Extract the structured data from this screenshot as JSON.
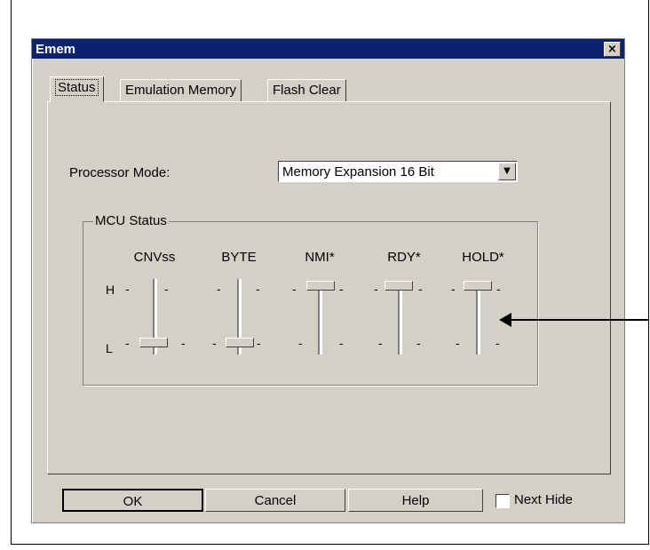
{
  "window": {
    "title": "Emem",
    "close_glyph": "×"
  },
  "tabs": [
    {
      "label": "Status",
      "active": true
    },
    {
      "label": "Emulation Memory",
      "active": false
    },
    {
      "label": "Flash Clear",
      "active": false
    }
  ],
  "processor_mode": {
    "label": "Processor Mode:",
    "value": "Memory Expansion 16 Bit"
  },
  "mcu_status": {
    "title": "MCU Status",
    "h_label": "H",
    "l_label": "L",
    "pins": [
      {
        "name": "CNVss",
        "level": "L"
      },
      {
        "name": "BYTE",
        "level": "L"
      },
      {
        "name": "NMI*",
        "level": "H"
      },
      {
        "name": "RDY*",
        "level": "H"
      },
      {
        "name": "HOLD*",
        "level": "H"
      }
    ]
  },
  "buttons": {
    "ok": "OK",
    "cancel": "Cancel",
    "help": "Help"
  },
  "next_hide": {
    "label": "Next Hide",
    "checked": false
  },
  "colors": {
    "titlebar": "#0a2270",
    "face": "#d4d0c8"
  }
}
